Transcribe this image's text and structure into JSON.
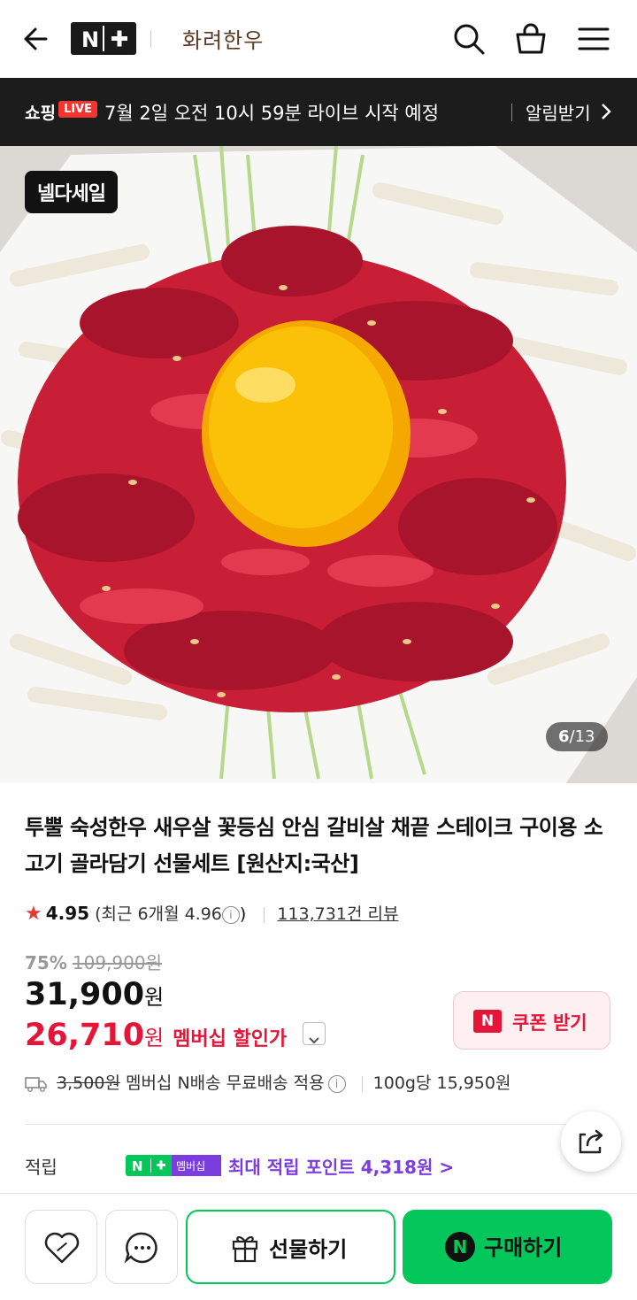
{
  "header": {
    "brand_badge": "N+",
    "store_name": "화려한우",
    "icons": [
      "back-arrow-icon",
      "search-icon",
      "cart-icon",
      "menu-icon"
    ]
  },
  "live_banner": {
    "shop_label": "쇼핑",
    "live_badge": "LIVE",
    "text": "7월 2일 오전 10시 59분 라이브 시작 예정",
    "alarm_label": "알림받기"
  },
  "hero": {
    "sale_tag": "넬다세일",
    "page_current": "6",
    "page_total": "/13"
  },
  "product": {
    "title": "투뿔 숙성한우 새우살 꽃등심 안심 갈비살 채끝 스테이크 구이용 소고기 골라담기 선물세트 [원산지:국산]",
    "rating": "4.95",
    "recent_rating": "(최근 6개월 4.96",
    "recent_close": ")",
    "review_count": "113,731건 리뷰",
    "discount_pct": "75%",
    "original_price": "109,900원",
    "price": "31,900",
    "price_unit": "원",
    "member_price": "26,710",
    "member_price_unit": "원",
    "member_label": "멤버십 할인가",
    "coupon_label": "쿠폰 받기",
    "coupon_icon_text": "N",
    "shipping_fee": "3,500원",
    "shipping_text": "멤버십 N배송 무료배송 적용",
    "unit_price": "100g당 15,950원",
    "points_label": "적립",
    "points_badge_label": "멤버십",
    "points_text": "최대 적립 포인트 4,318원 >"
  },
  "bottom_bar": {
    "gift_label": "선물하기",
    "buy_label": "구매하기",
    "buy_icon_text": "N"
  },
  "colors": {
    "naver_green": "#03c75a",
    "price_red": "#e5153a",
    "points_purple": "#7b3ce0",
    "live_red": "#f2362f"
  }
}
